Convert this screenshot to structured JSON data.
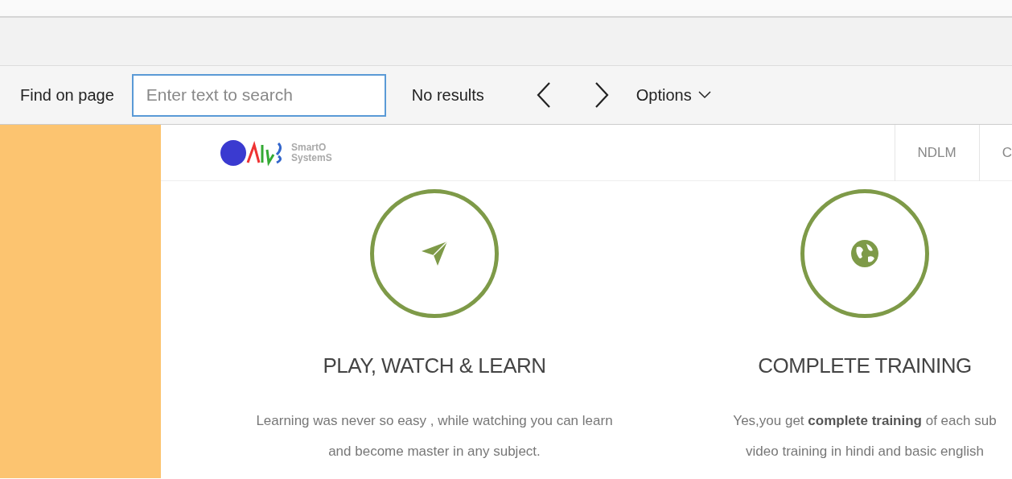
{
  "find_bar": {
    "label": "Find on page",
    "search": {
      "placeholder": "Enter text to search"
    },
    "result": "No results",
    "options": "Options"
  },
  "site": {
    "logo": {
      "line_1": "SmartO",
      "line_2": "SystemS"
    },
    "nav": [
      {
        "label": "NDLM"
      },
      {
        "label": "C"
      }
    ],
    "features": [
      {
        "kind": "send",
        "title": "PLAY, WATCH & LEARN",
        "lines": [
          "Learning was never so easy , while watching you can learn",
          "and become master in any subject."
        ]
      },
      {
        "kind": "globe",
        "title": "COMPLETE TRAINING",
        "lines": [
          "Yes,you get **complete training** of each sub",
          "video training in hindi and basic english"
        ]
      }
    ]
  }
}
